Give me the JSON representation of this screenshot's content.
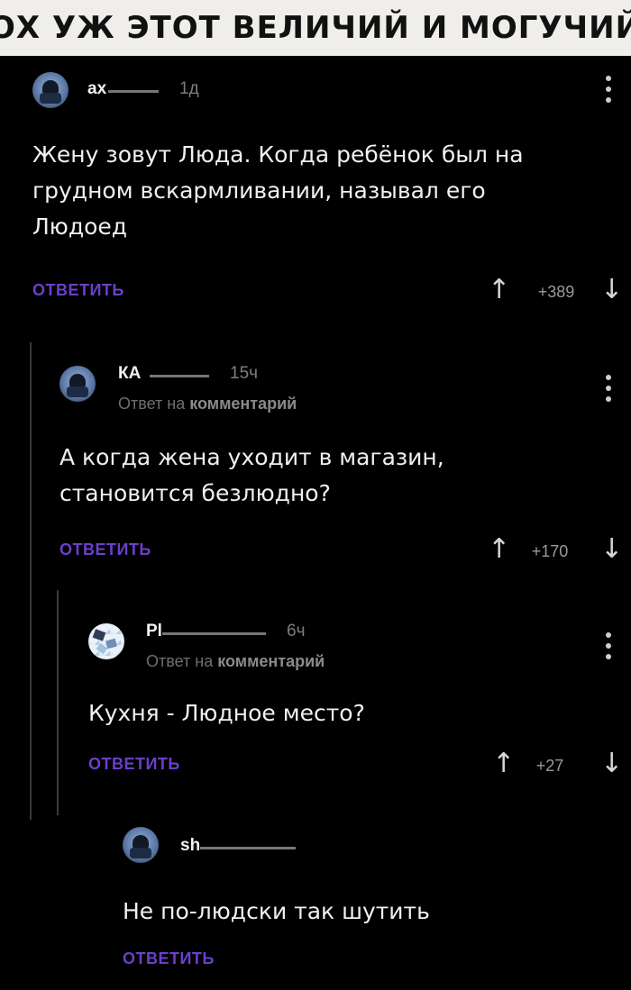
{
  "banner": {
    "title": "ОХ УЖ ЭТОТ ВЕЛИЧИЙ И МОГУЧИЙ"
  },
  "comments": [
    {
      "username": "ax",
      "time": "1д",
      "text_lines": [
        "Жену зовут Люда. Когда ребёнок был на",
        "грудном вскармливании, называл его",
        "Людоед"
      ],
      "reply_label": "ОТВЕТИТЬ",
      "score": "+389",
      "avatar": "pilot-helmet-avatar"
    },
    {
      "username": "КА",
      "time": "15ч",
      "reply_ref_prefix": "Ответ на ",
      "reply_ref_link": "комментарий",
      "text_lines": [
        "А когда жена уходит в магазин,",
        "становится безлюдно?"
      ],
      "reply_label": "ОТВЕТИТЬ",
      "score": "+170",
      "avatar": "pilot-helmet-avatar"
    },
    {
      "username": "Pl",
      "time": "6ч",
      "reply_ref_prefix": "Ответ на ",
      "reply_ref_link": "комментарий",
      "text_lines": [
        "Кухня - Людное место?"
      ],
      "reply_label": "ОТВЕТИТЬ",
      "score": "+27",
      "avatar": "mosaic-avatar"
    },
    {
      "username": "sh",
      "text_lines": [
        "Не по-людски так шутить"
      ],
      "reply_label": "ОТВЕТИТЬ",
      "avatar": "pilot-helmet-avatar"
    }
  ],
  "icons": {
    "upvote": "↑",
    "downvote": "↓",
    "menu": "vertical-dots-icon"
  },
  "colors": {
    "background": "#000000",
    "reply_accent": "#6b3fc9",
    "banner_bg": "#f0eeea"
  }
}
